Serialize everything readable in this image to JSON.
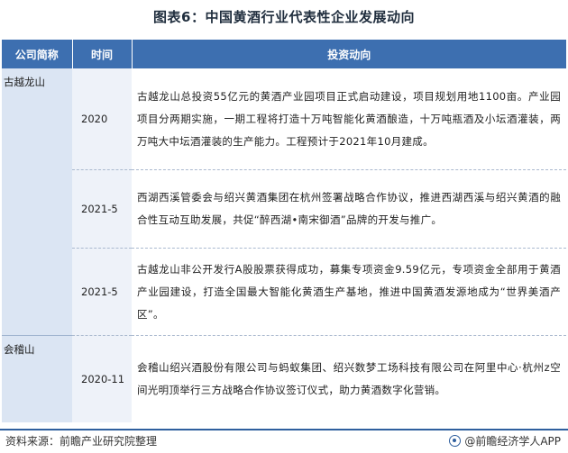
{
  "title": "图表6：中国黄酒行业代表性企业发展动向",
  "table": {
    "headers": [
      "公司简称",
      "时间",
      "投资动向"
    ],
    "companies": [
      "古越龙山",
      "会稽山"
    ],
    "rows": [
      {
        "time": "2020",
        "desc": "古越龙山总投资55亿元的黄酒产业园项目正式启动建设，项目规划用地1100亩。产业园项目分两期实施，一期工程将打造十万吨智能化黄酒酿造，十万吨瓶酒及小坛酒灌装，两万吨大中坛酒灌装的生产能力。工程预计于2021年10月建成。"
      },
      {
        "time": "2021-5",
        "desc": "西湖西溪管委会与绍兴黄酒集团在杭州签署战略合作协议，推进西湖西溪与绍兴黄酒的融合性互动互助发展，共促“醉西湖•南宋御酒”品牌的开发与推广。"
      },
      {
        "time": "2021-5",
        "desc": "古越龙山非公开发行A股股票获得成功，募集专项资金9.59亿元，专项资金全部用于黄酒产业园建设，打造全国最大智能化黄酒生产基地，推进中国黄酒发源地成为“世界美酒产区”。"
      },
      {
        "time": "2020-11",
        "desc": "会稽山绍兴酒股份有限公司与蚂蚁集团、绍兴数梦工场科技有限公司在阿里中心·杭州z空间光明顶举行三方战略合作协议签订仪式，助力黄酒数字化营销。"
      }
    ]
  },
  "footer": {
    "source": "资料来源：前瞻产业研究院整理",
    "brand": "@前瞻经济学人APP"
  },
  "watermark": "前瞻产业研究院",
  "colors": {
    "header_bg": "#3d6fb0",
    "company_bg": "#dbe5f3",
    "time_bg": "#eef2f9",
    "rule": "#2f5f9e"
  }
}
